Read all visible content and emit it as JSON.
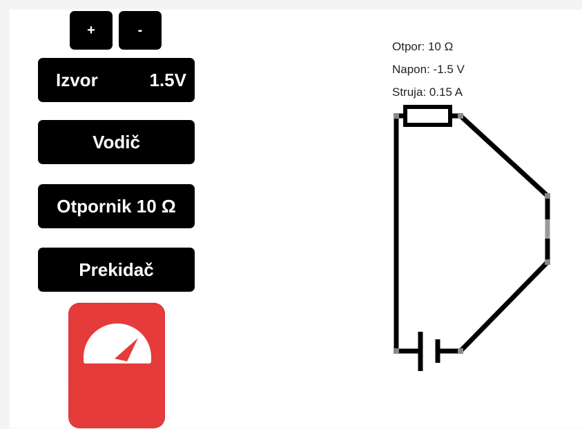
{
  "toolbar": {
    "plus_label": "+",
    "minus_label": "-"
  },
  "components": {
    "source": {
      "label": "Izvor",
      "value": "1.5V"
    },
    "wire": {
      "label": "Vodič"
    },
    "resistor": {
      "label": "Otpornik 10 Ω"
    },
    "switch": {
      "label": "Prekidač"
    },
    "meter": {
      "icon": "gauge-icon",
      "color": "#e53b3b"
    }
  },
  "readouts": {
    "resistance": "Otpor: 10 Ω",
    "voltage": "Napon: -1.5 V",
    "current": "Struja: 0.15 A"
  }
}
